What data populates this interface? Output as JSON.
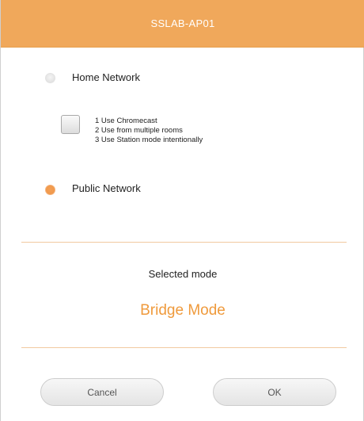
{
  "dialog": {
    "title": "SSLAB-AP01"
  },
  "options": {
    "home_network": {
      "label": "Home Network",
      "selected": false
    },
    "conditions": [
      "1 Use Chromecast",
      "2 Use from multiple rooms",
      "3 Use Station mode intentionally"
    ],
    "condition_checkbox_checked": false,
    "public_network": {
      "label": "Public Network",
      "selected": true
    }
  },
  "mode": {
    "label": "Selected mode",
    "value": "Bridge Mode"
  },
  "buttons": {
    "cancel": "Cancel",
    "ok": "OK"
  },
  "colors": {
    "accent": "#f0a85b",
    "mode_text": "#ef9a3c"
  }
}
